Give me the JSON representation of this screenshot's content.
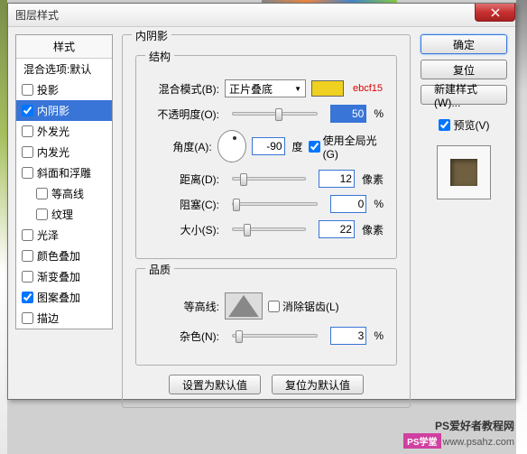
{
  "dialog": {
    "title": "图层样式",
    "close": "×"
  },
  "styles": {
    "header": "样式",
    "blend_options": "混合选项:默认",
    "items": [
      {
        "label": "投影",
        "checked": false
      },
      {
        "label": "内阴影",
        "checked": true,
        "selected": true
      },
      {
        "label": "外发光",
        "checked": false
      },
      {
        "label": "内发光",
        "checked": false
      },
      {
        "label": "斜面和浮雕",
        "checked": false
      },
      {
        "label": "等高线",
        "checked": false,
        "indent": true
      },
      {
        "label": "纹理",
        "checked": false,
        "indent": true
      },
      {
        "label": "光泽",
        "checked": false
      },
      {
        "label": "颜色叠加",
        "checked": false
      },
      {
        "label": "渐变叠加",
        "checked": false
      },
      {
        "label": "图案叠加",
        "checked": true
      },
      {
        "label": "描边",
        "checked": false
      }
    ]
  },
  "inner_shadow": {
    "title": "内阴影",
    "structure": {
      "title": "结构",
      "blend_mode_label": "混合模式(B):",
      "blend_mode_value": "正片叠底",
      "color_hex": "ebcf15",
      "opacity_label": "不透明度(O):",
      "opacity_value": "50",
      "opacity_unit": "%",
      "angle_label": "角度(A):",
      "angle_value": "-90",
      "angle_unit": "度",
      "global_light_label": "使用全局光(G)",
      "global_light_checked": true,
      "distance_label": "距离(D):",
      "distance_value": "12",
      "distance_unit": "像素",
      "choke_label": "阻塞(C):",
      "choke_value": "0",
      "choke_unit": "%",
      "size_label": "大小(S):",
      "size_value": "22",
      "size_unit": "像素"
    },
    "quality": {
      "title": "品质",
      "contour_label": "等高线:",
      "antialias_label": "消除锯齿(L)",
      "antialias_checked": false,
      "noise_label": "杂色(N):",
      "noise_value": "3",
      "noise_unit": "%"
    },
    "set_default": "设置为默认值",
    "reset_default": "复位为默认值"
  },
  "buttons": {
    "ok": "确定",
    "cancel": "复位",
    "new_style": "新建样式(W)...",
    "preview_label": "预览(V)",
    "preview_checked": true
  },
  "watermark": {
    "text": "PS爱好者教程网",
    "badge": "PS学堂",
    "url": "www.psahz.com"
  }
}
